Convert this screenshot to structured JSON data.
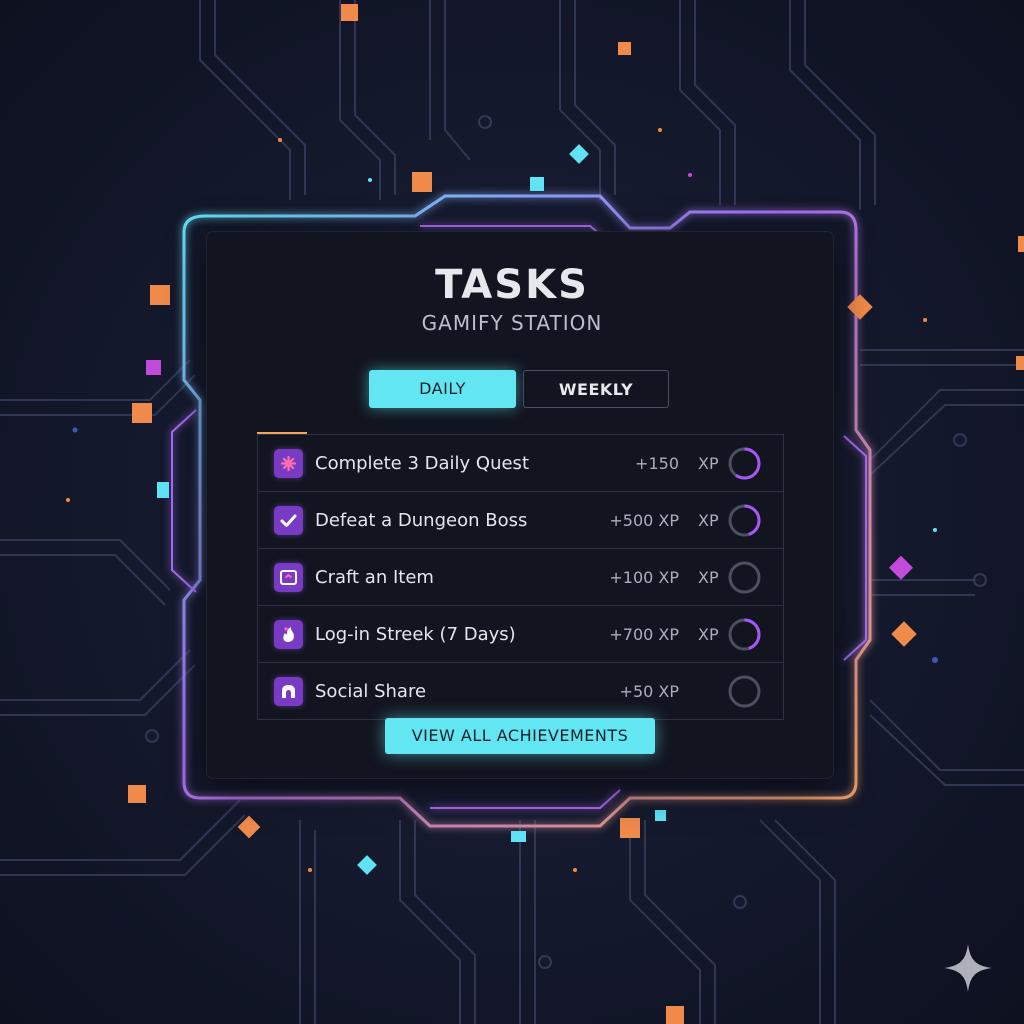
{
  "header": {
    "title": "TASKS",
    "subtitle": "GAMIFY STATION"
  },
  "tabs": [
    {
      "label": "DAILY",
      "active": true
    },
    {
      "label": "WEEKLY",
      "active": false
    }
  ],
  "tasks": [
    {
      "label": "Complete 3 Daily Quest",
      "xp": "+150",
      "unit": "XP",
      "icon": "sparkle-star-icon",
      "progress": 0.6
    },
    {
      "label": "Defeat a Dungeon Boss",
      "xp": "+500 XP",
      "unit": "XP",
      "icon": "checkmark-icon",
      "progress": 0.45
    },
    {
      "label": "Craft an Item",
      "xp": "+100 XP",
      "unit": "XP",
      "icon": "crafting-screen-icon",
      "progress": 0
    },
    {
      "label": "Log-in Streek (7 Days)",
      "xp": "+700 XP",
      "unit": "XP",
      "icon": "flame-icon",
      "progress": 0.45
    },
    {
      "label": "Social Share",
      "xp": "+50 XP",
      "unit": "",
      "icon": "share-arch-icon",
      "progress": 0
    }
  ],
  "footer": {
    "button_label": "VIEW ALL ACHIEVEMENTS"
  },
  "colors": {
    "accent_cyan": "#62e6f2",
    "accent_purple": "#a855f7",
    "accent_orange": "#f2a65a",
    "panel_bg": "#12151f",
    "page_bg": "#151a2e"
  }
}
